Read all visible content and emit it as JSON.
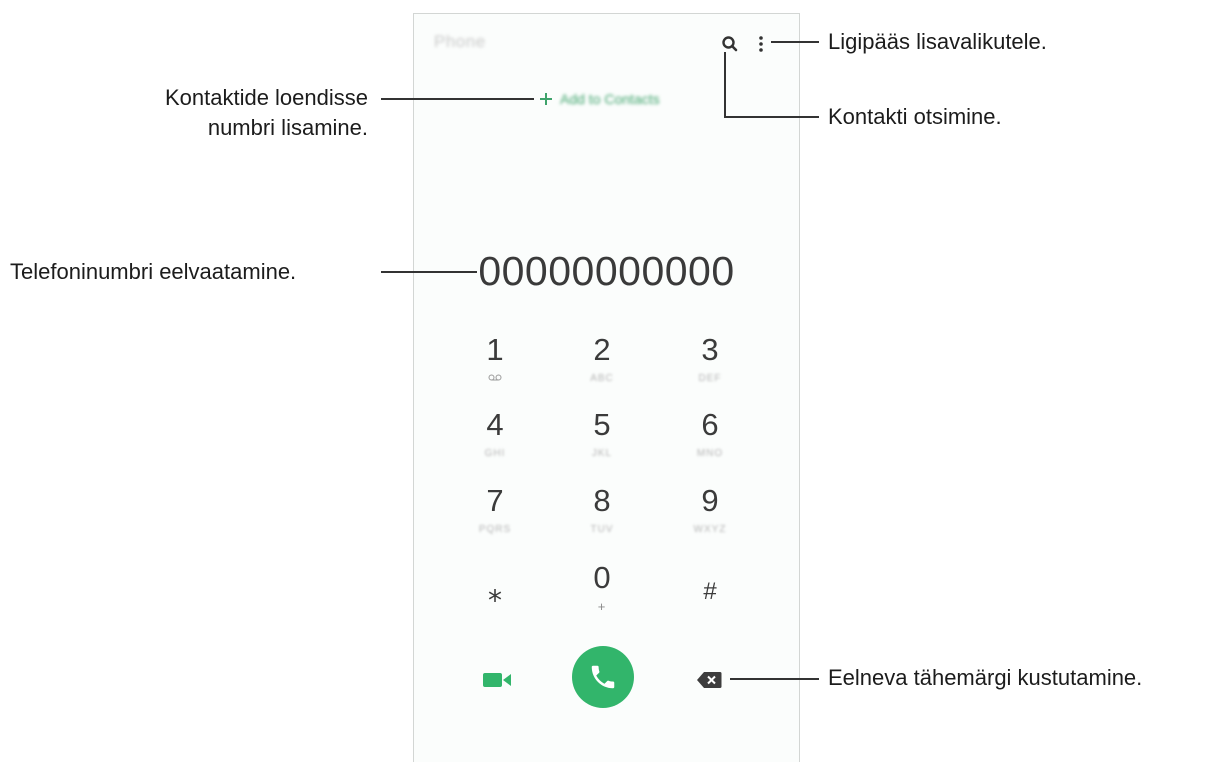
{
  "app": {
    "title": "Phone",
    "add_to_contacts_label": "Add to Contacts",
    "number": "00000000000"
  },
  "keypad": [
    {
      "digit": "1",
      "sub": "voicemail-icon"
    },
    {
      "digit": "2",
      "sub": "ABC"
    },
    {
      "digit": "3",
      "sub": "DEF"
    },
    {
      "digit": "4",
      "sub": "GHI"
    },
    {
      "digit": "5",
      "sub": "JKL"
    },
    {
      "digit": "6",
      "sub": "MNO"
    },
    {
      "digit": "7",
      "sub": "PQRS"
    },
    {
      "digit": "8",
      "sub": "TUV"
    },
    {
      "digit": "9",
      "sub": "WXYZ"
    },
    {
      "digit": "⁎",
      "sub": ""
    },
    {
      "digit": "0",
      "sub": "+"
    },
    {
      "digit": "#",
      "sub": ""
    }
  ],
  "annotations": {
    "more_options": "Ligipääs lisavalikutele.",
    "add_contact_line1": "Kontaktide loendisse",
    "add_contact_line2": "numbri lisamine.",
    "search_contact": "Kontakti otsimine.",
    "number_preview": "Telefoninumbri eelvaatamine.",
    "delete_char": "Eelneva tähemärgi kustutamine."
  },
  "icons": {
    "search": "search-icon",
    "more": "more-options-icon",
    "add": "plus-icon",
    "video": "video-call-icon",
    "call": "phone-call-icon",
    "backspace": "backspace-icon",
    "voicemail": "voicemail-icon"
  },
  "colors": {
    "accent_green": "#32b56b",
    "text_dark": "#3b3b3b"
  }
}
